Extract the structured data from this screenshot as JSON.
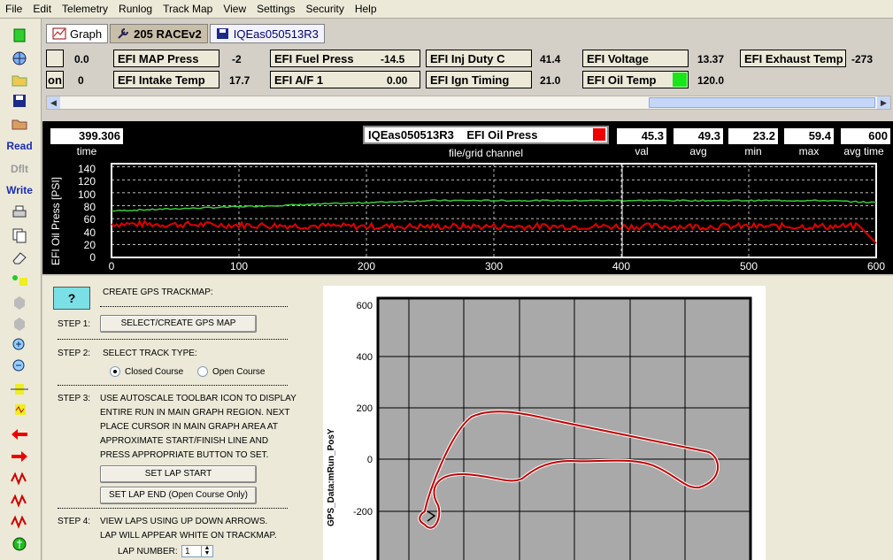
{
  "menu": [
    "File",
    "Edit",
    "Telemetry",
    "Runlog",
    "Track Map",
    "View",
    "Settings",
    "Security",
    "Help"
  ],
  "toolbar": {
    "read_label": "Read",
    "dflt_label": "Dflt",
    "write_label": "Write"
  },
  "tabs": {
    "graph": "Graph",
    "race": "205 RACEv2",
    "file": "IQEas050513R3"
  },
  "channels": {
    "row1": [
      {
        "label": "",
        "value": "0.0"
      },
      {
        "label": "EFI MAP Press",
        "value": "-2"
      },
      {
        "label": "EFI Fuel Press",
        "value": "-14.5"
      },
      {
        "label": "EFI Inj Duty C",
        "value": "41.4"
      },
      {
        "label": "EFI Voltage",
        "value": "13.37"
      },
      {
        "label": "EFI Exhaust Temp",
        "value": "-273"
      }
    ],
    "row2": [
      {
        "label": "on",
        "value": "0"
      },
      {
        "label": "EFI Intake Temp",
        "value": "17.7"
      },
      {
        "label": "EFI A/F 1",
        "value": "0.00"
      },
      {
        "label": "EFI Ign Timing",
        "value": "21.0"
      },
      {
        "label": "EFI Oil Temp",
        "value": "120.0"
      }
    ]
  },
  "graph": {
    "time_value": "399.306",
    "time_label": "time",
    "channel_file": "IQEas050513R3",
    "channel_name": "EFI Oil Press",
    "channel_caption": "file/grid channel",
    "val": "45.3",
    "val_label": "val",
    "avg": "49.3",
    "avg_label": "avg",
    "min": "23.2",
    "min_label": "min",
    "max": "59.4",
    "max_label": "max",
    "avg_time": "600",
    "avg_time_label": "avg time",
    "ylabel": "EFI Oil Press [PSI]",
    "yticks": [
      "140",
      "120",
      "100",
      "80",
      "60",
      "40",
      "20",
      "0"
    ],
    "xticks": [
      "0",
      "100",
      "200",
      "300",
      "400",
      "500",
      "600"
    ],
    "colors": {
      "red_trace": "#e00000",
      "green_trace": "#3cc83c"
    }
  },
  "gps": {
    "help": "?",
    "title": "CREATE GPS TRACKMAP:",
    "step1": "STEP 1:",
    "step1_btn": "SELECT/CREATE  GPS MAP",
    "step2": "STEP 2:",
    "step2_text": "SELECT TRACK TYPE:",
    "closed": "Closed Course",
    "open": "Open Course",
    "step3": "STEP 3:",
    "step3_lines": [
      "USE AUTOSCALE TOOLBAR ICON TO DISPLAY",
      "ENTIRE RUN IN MAIN GRAPH REGION. NEXT",
      "PLACE CURSOR IN MAIN GRAPH AREA AT",
      "APPROXIMATE START/FINISH LINE  AND",
      "PRESS APPROPRIATE BUTTON TO SET."
    ],
    "lap_start": "SET LAP START",
    "lap_end": "SET LAP END (Open Course Only)",
    "step4": "STEP 4:",
    "step4_lines": [
      "VIEW LAPS USING UP DOWN ARROWS.",
      "LAP WILL APPEAR WHITE ON TRACKMAP."
    ],
    "lap_number_label": "LAP NUMBER:",
    "lap_number": "1"
  },
  "trackmap": {
    "ylabel": "GPS_Data:mRun_PosY",
    "yticks": [
      "600",
      "400",
      "200",
      "0",
      "-200"
    ]
  }
}
